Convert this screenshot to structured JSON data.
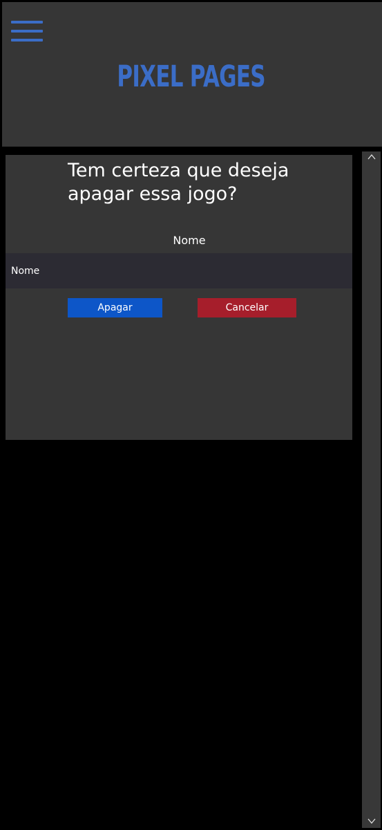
{
  "header": {
    "brand": "PIXEL PAGES",
    "menu_icon": "hamburger-menu-icon",
    "accent_color": "#3b6dc7"
  },
  "dialog": {
    "title": "Tem certeza que deseja apagar essa jogo?",
    "field_label": "Nome",
    "field_placeholder": "Nome",
    "delete_label": "Apagar",
    "cancel_label": "Cancelar",
    "delete_color": "#0d56c8",
    "cancel_color": "#a61e2b"
  },
  "scrollbar": {
    "up_icon": "chevron-up-icon",
    "down_icon": "chevron-down-icon"
  }
}
